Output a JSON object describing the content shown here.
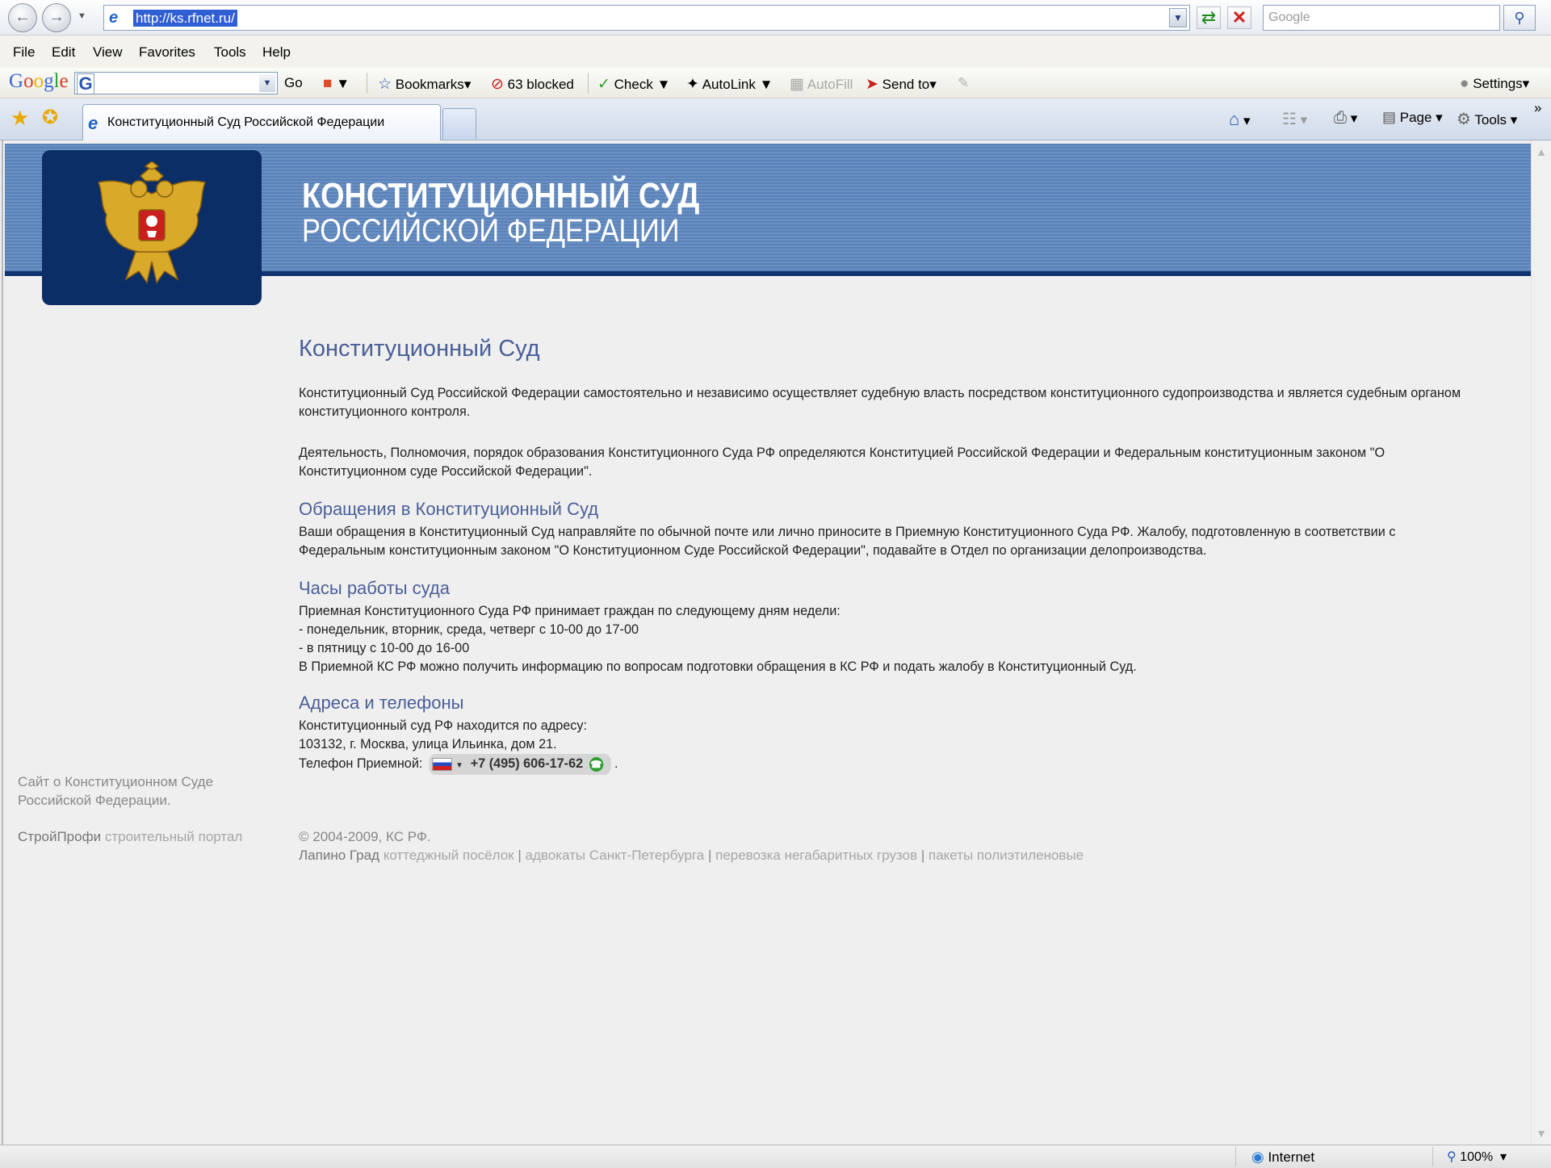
{
  "browser": {
    "url": "http://ks.rfnet.ru/",
    "search_placeholder": "Google",
    "menu": [
      "File",
      "Edit",
      "View",
      "Favorites",
      "Tools",
      "Help"
    ],
    "google_toolbar": {
      "logo": "Google",
      "go_label": "Go",
      "bookmarks_label": "Bookmarks",
      "blocked_label": "63 blocked",
      "check_label": "Check",
      "autolink_label": "AutoLink",
      "autofill_label": "AutoFill",
      "sendto_label": "Send to",
      "settings_label": "Settings"
    },
    "tab_title": "Конституционный Суд Российской Федерации",
    "command_bar": {
      "page_label": "Page",
      "tools_label": "Tools"
    },
    "status": {
      "zone": "Internet",
      "zoom": "100%"
    }
  },
  "page": {
    "banner": {
      "title_line1": "КОНСТИТУЦИОННЫЙ СУД",
      "title_line2": "РОССИЙСКОЙ ФЕДЕРАЦИИ"
    },
    "main_title": "Конституционный Суд",
    "intro_p1": "Конституционный Суд Российской Федерации самостоятельно и независимо осуществляет судебную власть посредством конституционного судопроизводства и является судебным органом конституционного контроля.",
    "intro_p2": "Деятельность, Полномочия, порядок образования Конституционного Суда РФ определяются Конституцией Российской Федерации и Федеральным конституционным законом \"О Конституционном суде Российской Федерации\".",
    "appeals": {
      "heading": "Обращения в Конституционный Суд",
      "text": "Ваши обращения в Конституционный Суд направляйте по обычной почте или лично приносите в Приемную Конституционного Суда РФ. Жалобу, подготовленную в соответствии с Федеральным конституционным законом \"О Конституционном Суде Российской Федерации\", подавайте в Отдел по организации делопроизводства."
    },
    "hours": {
      "heading": "Часы работы суда",
      "line1": "Приемная Конституционного Суда РФ принимает граждан по следующему дням недели:",
      "line2": "- понедельник, вторник, среда, четверг с 10-00 до 17-00",
      "line3": "- в пятницу с 10-00 до 16-00",
      "line4": "В Приемной КС РФ можно получить информацию по вопросам подготовки обращения в КС РФ и подать жалобу в Конституционный Суд."
    },
    "contacts": {
      "heading": "Адреса и телефоны",
      "line1": "Конституционный суд РФ находится по адресу:",
      "line2": "103132, г. Москва, улица Ильинка, дом 21.",
      "phone_label": "Телефон Приемной:",
      "phone": "+7 (495) 606-17-62",
      "phone_suffix": "."
    },
    "sidebar": {
      "about": "Сайт о Конституционном Суде Российской Федерации.",
      "stroyprofi_link": "СтройПрофи",
      "stroyprofi_text": "строительный портал"
    },
    "footer": {
      "copyright": "© 2004-2009, КС РФ.",
      "lapino": "Лапино Град",
      "link1": "коттеджный посёлок",
      "sep": "|",
      "link2": "адвокаты Санкт-Петербурга",
      "link3": "перевозка негабаритных грузов",
      "link4": "пакеты полиэтиленовые"
    }
  }
}
